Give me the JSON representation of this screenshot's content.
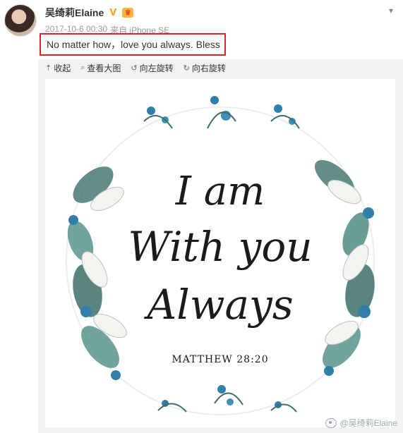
{
  "post": {
    "username": "吴绮莉Elaine",
    "verified_badge": "V",
    "timestamp": "2017-10-6 00:30",
    "source": "来自 iPhone SE",
    "text": "No matter how，love you always. Bless"
  },
  "toolbar": {
    "collapse": "收起",
    "view_large": "查看大图",
    "rotate_left": "向左旋转",
    "rotate_right": "向右旋转"
  },
  "image": {
    "line1": "I am",
    "line2": "With you",
    "line3": "Always",
    "reference": "MATTHEW 28:20"
  },
  "watermark": "@吴绮莉Elaine",
  "colors": {
    "highlight_border": "#e0232b",
    "flower_blue": "#2f7fa8",
    "leaf_teal": "#3d6f6a"
  },
  "icons": {
    "verified": "verified-v-icon",
    "vip": "crown-icon",
    "more": "chevron-down-icon"
  }
}
